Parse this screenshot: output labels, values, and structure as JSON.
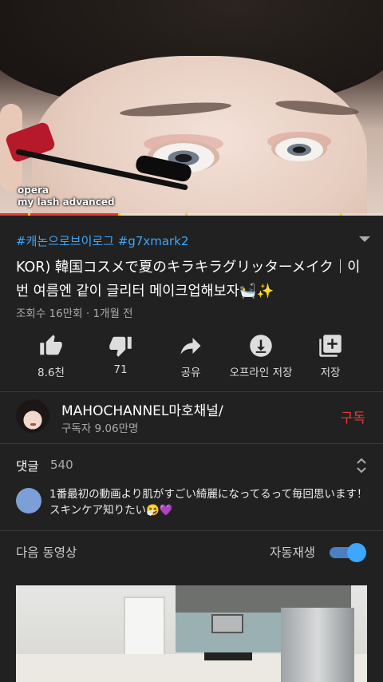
{
  "video": {
    "caption_line1": "opera",
    "caption_line2": "my lash advanced",
    "progress_fraction": 0.31
  },
  "hashtags": "#캐논으로브이로그 #g7xmark2",
  "title": "KOR) 韓国コスメで夏のキラキラグリッターメイク｜이번 여름엔 같이 글리터 메이크업해보자🛀✨",
  "meta": "조회수 16만회 · 1개월 전",
  "actions": [
    {
      "icon": "thumb-up-icon",
      "label": "8.6천"
    },
    {
      "icon": "thumb-down-icon",
      "label": "71"
    },
    {
      "icon": "share-icon",
      "label": "공유"
    },
    {
      "icon": "download-icon",
      "label": "오프라인 저장"
    },
    {
      "icon": "add-to-playlist-icon",
      "label": "저장"
    }
  ],
  "channel": {
    "name": "MAHOCHANNEL마호채널/",
    "subscribers": "구독자 9.06만명",
    "subscribe_label": "구독"
  },
  "comments": {
    "header": "댓글",
    "count": "540",
    "top_comment": "1番最初の動画より肌がすごい綺麗になってるって毎回思います！スキンケア知りたい🤧💜"
  },
  "up_next": {
    "label": "다음 동영상",
    "autoplay_label": "자동재생",
    "autoplay_on": true
  },
  "colors": {
    "background": "#212121",
    "accent_blue": "#3ea6ff",
    "subscribe_red": "#e53935"
  }
}
